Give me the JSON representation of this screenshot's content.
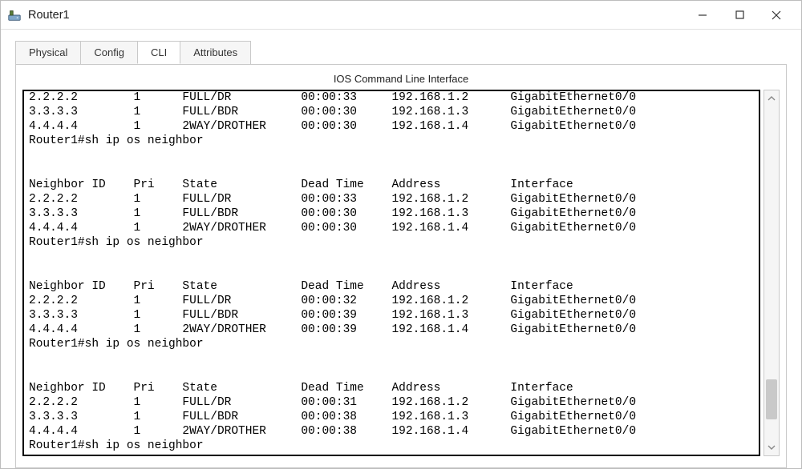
{
  "window": {
    "title": "Router1"
  },
  "tabs": [
    {
      "label": "Physical",
      "active": false
    },
    {
      "label": "Config",
      "active": false
    },
    {
      "label": "CLI",
      "active": true
    },
    {
      "label": "Attributes",
      "active": false
    }
  ],
  "cli_title": "IOS Command Line Interface",
  "prompt_command": "Router1#sh ip os neighbor",
  "headers": [
    "Neighbor ID",
    "Pri",
    "State",
    "Dead Time",
    "Address",
    "Interface"
  ],
  "scratch_row": {
    "id": "2.2.2.2",
    "pri": "1",
    "state": "FULL/DR",
    "dead": "00:00:33",
    "addr": "192.168.1.2",
    "iface": "GigabitEthernet0/0"
  },
  "blocks": [
    {
      "partial_top": [
        {
          "id": "3.3.3.3",
          "pri": "1",
          "state": "FULL/BDR",
          "dead": "00:00:30",
          "addr": "192.168.1.3",
          "iface": "GigabitEthernet0/0"
        },
        {
          "id": "4.4.4.4",
          "pri": "1",
          "state": "2WAY/DROTHER",
          "dead": "00:00:30",
          "addr": "192.168.1.4",
          "iface": "GigabitEthernet0/0"
        }
      ]
    },
    {
      "rows": [
        {
          "id": "2.2.2.2",
          "pri": "1",
          "state": "FULL/DR",
          "dead": "00:00:33",
          "addr": "192.168.1.2",
          "iface": "GigabitEthernet0/0"
        },
        {
          "id": "3.3.3.3",
          "pri": "1",
          "state": "FULL/BDR",
          "dead": "00:00:30",
          "addr": "192.168.1.3",
          "iface": "GigabitEthernet0/0"
        },
        {
          "id": "4.4.4.4",
          "pri": "1",
          "state": "2WAY/DROTHER",
          "dead": "00:00:30",
          "addr": "192.168.1.4",
          "iface": "GigabitEthernet0/0"
        }
      ]
    },
    {
      "rows": [
        {
          "id": "2.2.2.2",
          "pri": "1",
          "state": "FULL/DR",
          "dead": "00:00:32",
          "addr": "192.168.1.2",
          "iface": "GigabitEthernet0/0"
        },
        {
          "id": "3.3.3.3",
          "pri": "1",
          "state": "FULL/BDR",
          "dead": "00:00:39",
          "addr": "192.168.1.3",
          "iface": "GigabitEthernet0/0"
        },
        {
          "id": "4.4.4.4",
          "pri": "1",
          "state": "2WAY/DROTHER",
          "dead": "00:00:39",
          "addr": "192.168.1.4",
          "iface": "GigabitEthernet0/0"
        }
      ]
    },
    {
      "rows": [
        {
          "id": "2.2.2.2",
          "pri": "1",
          "state": "FULL/DR",
          "dead": "00:00:31",
          "addr": "192.168.1.2",
          "iface": "GigabitEthernet0/0"
        },
        {
          "id": "3.3.3.3",
          "pri": "1",
          "state": "FULL/BDR",
          "dead": "00:00:38",
          "addr": "192.168.1.3",
          "iface": "GigabitEthernet0/0"
        },
        {
          "id": "4.4.4.4",
          "pri": "1",
          "state": "2WAY/DROTHER",
          "dead": "00:00:38",
          "addr": "192.168.1.4",
          "iface": "GigabitEthernet0/0"
        }
      ]
    }
  ],
  "scrollbar": {
    "thumb_top_pct": 82,
    "thumb_height_pct": 12
  }
}
